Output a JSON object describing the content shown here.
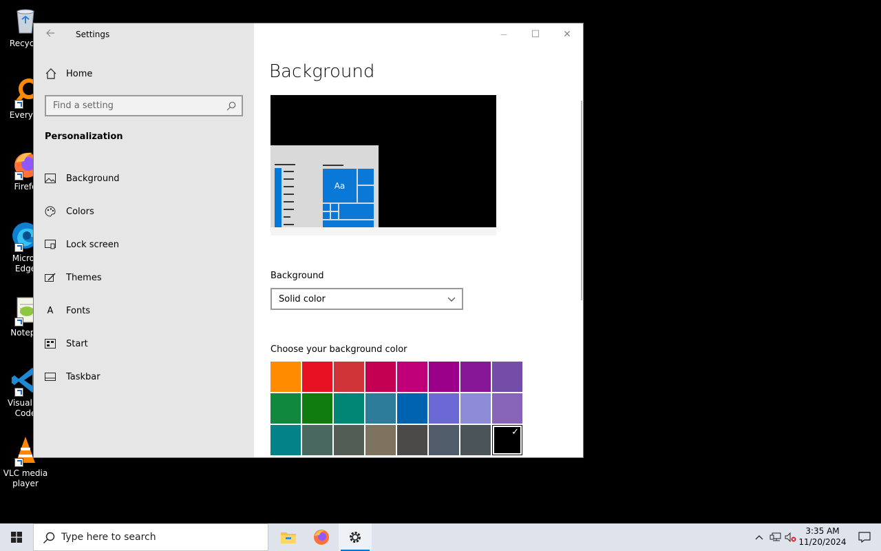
{
  "desktop": {
    "icons": [
      {
        "label": "Recycle",
        "icon": "recycle-bin-icon"
      },
      {
        "label": "Everyth",
        "icon": "everything-search-icon"
      },
      {
        "label": "Firefo",
        "icon": "firefox-icon"
      },
      {
        "label": "Micros\nEdge",
        "icon": "edge-icon"
      },
      {
        "label": "Notepa",
        "icon": "notepad-plus-icon"
      },
      {
        "label": "Visual St\nCode",
        "icon": "vscode-icon"
      },
      {
        "label": "VLC media\nplayer",
        "icon": "vlc-icon"
      }
    ]
  },
  "window": {
    "title": "Settings",
    "minimize": "—",
    "maximize": "☐",
    "close": "✕"
  },
  "sidebar": {
    "home_label": "Home",
    "search_placeholder": "Find a setting",
    "section_title": "Personalization",
    "items": [
      {
        "label": "Background",
        "icon": "picture-icon"
      },
      {
        "label": "Colors",
        "icon": "palette-icon"
      },
      {
        "label": "Lock screen",
        "icon": "lock-screen-icon"
      },
      {
        "label": "Themes",
        "icon": "brush-icon"
      },
      {
        "label": "Fonts",
        "icon": "fonts-icon"
      },
      {
        "label": "Start",
        "icon": "start-icon"
      },
      {
        "label": "Taskbar",
        "icon": "taskbar-icon"
      }
    ]
  },
  "main": {
    "page_title": "Background",
    "preview_tile_text": "Aa",
    "background_label": "Background",
    "background_value": "Solid color",
    "color_label": "Choose your background color",
    "colors": [
      "#ff8c00",
      "#e81123",
      "#d13438",
      "#c30052",
      "#bf0077",
      "#9a0089",
      "#881798",
      "#744da9",
      "#10893e",
      "#107c10",
      "#018574",
      "#2d7d9a",
      "#0063b1",
      "#6b69d6",
      "#8e8cd8",
      "#8764b8",
      "#038387",
      "#486860",
      "#525e54",
      "#7e735f",
      "#4c4a48",
      "#515c6b",
      "#4a5459",
      "#000000"
    ],
    "selected_color_index": 23,
    "check_mark": "✓"
  },
  "taskbar": {
    "search_placeholder": "Type here to search",
    "time": "3:35 AM",
    "date": "11/20/2024"
  },
  "accent": "#0078d7"
}
